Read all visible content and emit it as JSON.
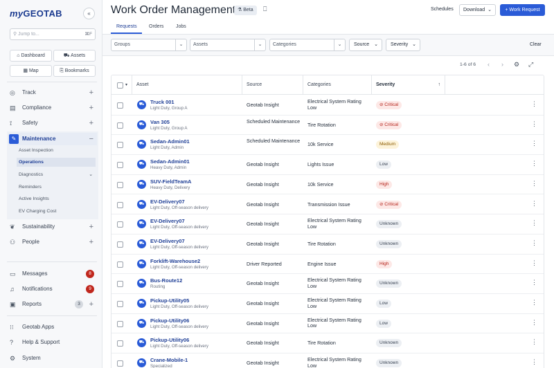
{
  "logo": {
    "my": "my",
    "brand": "GEOTAB"
  },
  "sidebar": {
    "collapse_icon": "«",
    "jump_placeholder": "Jump to...",
    "jump_shortcut": "⌘F",
    "quick_links": [
      {
        "label": "Dashboard",
        "icon": "home-icon"
      },
      {
        "label": "Assets",
        "icon": "truck-icon"
      },
      {
        "label": "Map",
        "icon": "map-icon"
      },
      {
        "label": "Bookmarks",
        "icon": "bookmark-icon"
      }
    ],
    "nav": [
      {
        "label": "Track",
        "icon": "globe-icon"
      },
      {
        "label": "Compliance",
        "icon": "clipboard-icon"
      },
      {
        "label": "Safety",
        "icon": "route-icon"
      },
      {
        "label": "Maintenance",
        "icon": "wrench-icon"
      },
      {
        "label": "Sustainability",
        "icon": "leaf-icon"
      },
      {
        "label": "People",
        "icon": "people-icon"
      }
    ],
    "maintenance_sub": [
      "Asset Inspection",
      "Operations",
      "Diagnostics",
      "Reminders",
      "Active Insights",
      "EV Charging Cost"
    ],
    "bottom": [
      {
        "label": "Messages",
        "icon": "chat-icon",
        "badge": "8"
      },
      {
        "label": "Notifications",
        "icon": "bell-icon",
        "badge": "9"
      },
      {
        "label": "Reports",
        "icon": "report-icon",
        "badge": "3"
      },
      {
        "label": "Geotab Apps",
        "icon": "grid-icon"
      },
      {
        "label": "Help & Support",
        "icon": "help-icon"
      },
      {
        "label": "System",
        "icon": "gear-icon"
      }
    ]
  },
  "header": {
    "title": "Work Order Management",
    "beta": "Beta",
    "schedules": "Schedules",
    "download": "Download",
    "work_request": "Work Request",
    "tabs": [
      "Requests",
      "Orders",
      "Jobs"
    ]
  },
  "filters": {
    "groups": "Groups",
    "assets": "Assets",
    "categories": "Categories",
    "source": "Source",
    "severity": "Severity",
    "clear": "Clear"
  },
  "pager": {
    "range": "1-6 of 6"
  },
  "table": {
    "columns": {
      "asset": "Asset",
      "source": "Source",
      "categories": "Categories",
      "severity": "Severity"
    },
    "rows": [
      {
        "name": "Truck 001",
        "sub": "Light Duty, Group A",
        "source": "Geotab Insight",
        "category": "Electrical System Rating Low",
        "severity": "Critical"
      },
      {
        "name": "Van 305",
        "sub": "Light Duty, Group A",
        "source": "Scheduled Maintenance",
        "category": "Tire Rotation",
        "severity": "Critical"
      },
      {
        "name": "Sedan-Admin01",
        "sub": "Light Duty, Admin",
        "source": "Scheduled Maintenance",
        "category": "10k Service",
        "severity": "Medium"
      },
      {
        "name": "Sedan-Admin01",
        "sub": "Heavy Duty, Admin",
        "source": "Geotab Insight",
        "category": "Lights Issue",
        "severity": "Low"
      },
      {
        "name": "SUV-FieldTeamA",
        "sub": "Heavy Duty, Delivery",
        "source": "Geotab Insight",
        "category": "10k Service",
        "severity": "High"
      },
      {
        "name": "EV-Delivery07",
        "sub": "Light Duty, Off-season delivery",
        "source": "Geotab Insight",
        "category": "Transmission Issue",
        "severity": "Critical"
      },
      {
        "name": "EV-Delivery07",
        "sub": "Light Duty, Off-season delivery",
        "source": "Geotab Insight",
        "category": "Electrical System Rating Low",
        "severity": "Unknown"
      },
      {
        "name": "EV-Delivery07",
        "sub": "Light Duty, Off-season delivery",
        "source": "Geotab Insight",
        "category": "Tire Rotation",
        "severity": "Unknown"
      },
      {
        "name": "Forklift-Warehouse2",
        "sub": "Light Duty, Off-season delivery",
        "source": "Driver Reported",
        "category": "Engine Issue",
        "severity": "High"
      },
      {
        "name": "Bus-Route12",
        "sub": "Routing",
        "source": "Geotab Insight",
        "category": "Electrical System Rating Low",
        "severity": "Unknown"
      },
      {
        "name": "Pickup-Utility05",
        "sub": "Light Duty, Off-season delivery",
        "source": "Geotab Insight",
        "category": "Electrical System Rating Low",
        "severity": "Low"
      },
      {
        "name": "Pickup-Utility06",
        "sub": "Light Duty, Off-season delivery",
        "source": "Geotab Insight",
        "category": "Electrical System Rating Low",
        "severity": "Low"
      },
      {
        "name": "Pickup-Utility06",
        "sub": "Light Duty, Off-season delivery",
        "source": "Geotab Insight",
        "category": "Tire Rotation",
        "severity": "Unknown"
      },
      {
        "name": "Crane-Mobile-1",
        "sub": "Specialized",
        "source": "Geotab Insight",
        "category": "Electrical System Rating Low",
        "severity": "Unknown"
      }
    ]
  },
  "colors": {
    "accent": "#2a5bd7",
    "critical": "#b4231a",
    "badge_red": "#c0271d"
  }
}
